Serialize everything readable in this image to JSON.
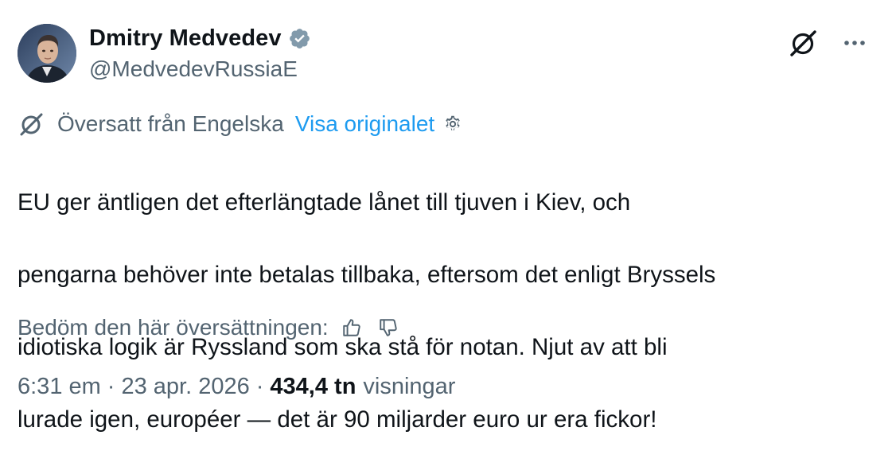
{
  "author": {
    "display_name": "Dmitry Medvedev",
    "handle": "@MedvedevRussiaE",
    "avatar_icon": "user-avatar-photo",
    "verified_icon": "verified-badge-icon",
    "verified_color": "#829aab"
  },
  "header_actions": {
    "grok_icon": "grok-icon",
    "more_icon": "more-dots-icon"
  },
  "translation": {
    "label": "Översatt från Engelska",
    "show_original": "Visa originalet",
    "settings_icon": "gear-icon",
    "link_color": "#1d9bf0"
  },
  "tweet": {
    "lines": [
      "EU ger äntligen det efterlängtade lånet till tjuven i Kiev, och",
      "pengarna behöver inte betalas tillbaka, eftersom det enligt Bryssels",
      "idiotiska logik är Ryssland som ska stå för notan. Njut av att bli",
      "lurade igen, européer — det är 90 miljarder euro ur era fickor!"
    ]
  },
  "rating": {
    "label": "Bedöm den här översättningen:",
    "thumbs_up_icon": "thumbs-up-icon",
    "thumbs_down_icon": "thumbs-down-icon"
  },
  "meta": {
    "time": "6:31 em",
    "date": "23 apr. 2026",
    "separator": "·",
    "views_count": "434,4 tn",
    "views_label": "visningar"
  }
}
